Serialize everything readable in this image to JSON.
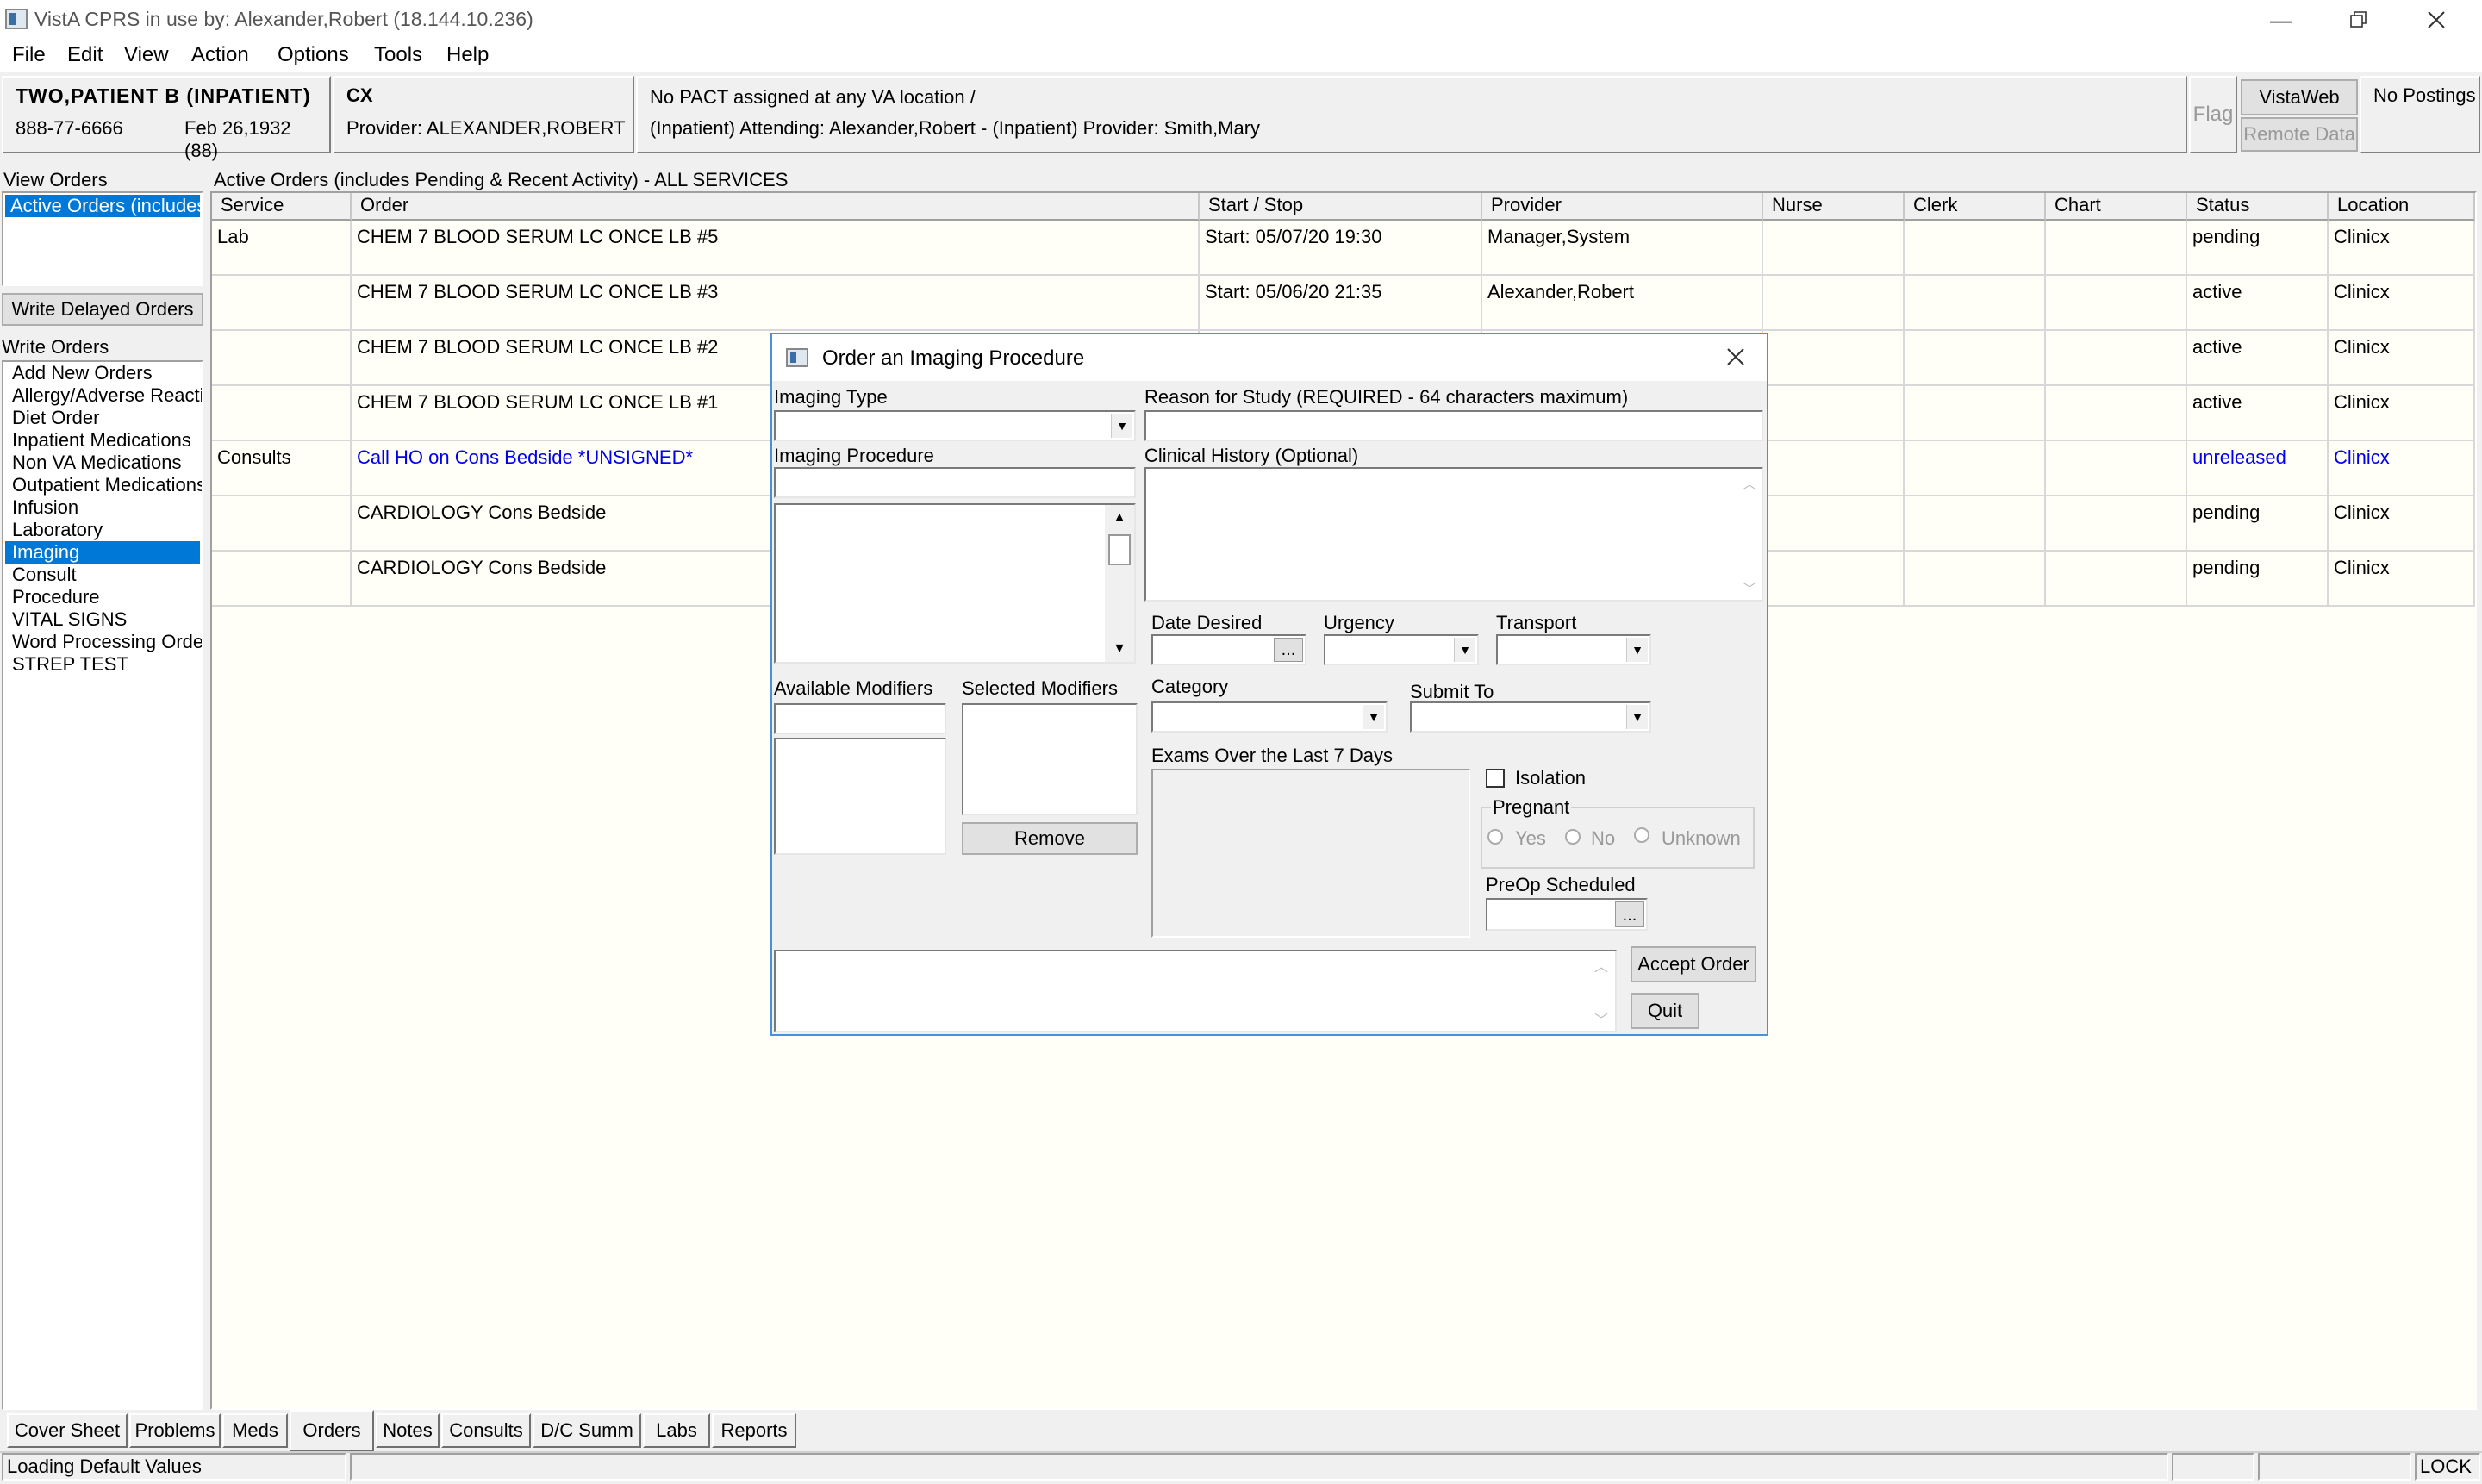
{
  "window": {
    "title": "VistA CPRS in use by: Alexander,Robert  (18.144.10.236)"
  },
  "menu": [
    "File",
    "Edit",
    "View",
    "Action",
    "Options",
    "Tools",
    "Help"
  ],
  "header": {
    "patient_name": "TWO,PATIENT B (INPATIENT)",
    "patient_ssn": "888-77-6666",
    "patient_dob": "Feb 26,1932 (88)",
    "location_code": "CX",
    "provider": "Provider:  ALEXANDER,ROBERT",
    "pact_line1": "No PACT assigned at any VA location /",
    "pact_line2": "(Inpatient) Attending:  Alexander,Robert - (Inpatient) Provider: Smith,Mary",
    "flag": "Flag",
    "vistaweb": "VistaWeb",
    "remote_data": "Remote Data",
    "postings": "No Postings"
  },
  "left_panel": {
    "view_orders_label": "View Orders",
    "view_orders_selected": "Active Orders (includes",
    "write_delayed_button": "Write Delayed Orders",
    "write_orders_label": "Write Orders",
    "write_orders_items": [
      "Add New Orders",
      "Allergy/Adverse Reacti",
      "Diet Order",
      "Inpatient Medications",
      "Non VA Medications",
      "Outpatient Medications",
      "Infusion",
      "Laboratory",
      "Imaging",
      "Consult",
      "Procedure",
      "VITAL SIGNS",
      "Word Processing Order",
      "STREP TEST"
    ],
    "selected_item": "Imaging"
  },
  "orders": {
    "caption": "Active Orders (includes Pending & Recent Activity) - ALL SERVICES",
    "columns": [
      "Service",
      "Order",
      "Start / Stop",
      "Provider",
      "Nurse",
      "Clerk",
      "Chart",
      "Status",
      "Location"
    ],
    "rows": [
      {
        "service": "Lab",
        "order": "CHEM 7 BLOOD   SERUM LC ONCE LB #5",
        "start": "Start: 05/07/20 19:30",
        "provider": "Manager,System",
        "status": "pending",
        "location": "Clinicx",
        "link": false
      },
      {
        "service": "",
        "order": "CHEM 7 BLOOD   SERUM LC ONCE LB #3",
        "start": "Start: 05/06/20 21:35",
        "provider": "Alexander,Robert",
        "status": "active",
        "location": "Clinicx",
        "link": false
      },
      {
        "service": "",
        "order": "CHEM 7 BLOOD   SERUM LC ONCE LB #2",
        "start": "",
        "provider": "",
        "status": "active",
        "location": "Clinicx",
        "link": false
      },
      {
        "service": "",
        "order": "CHEM 7 BLOOD   SERUM LC ONCE LB #1",
        "start": "",
        "provider": "",
        "status": "active",
        "location": "Clinicx",
        "link": false
      },
      {
        "service": "Consults",
        "order": "Call HO on Cons Bedside *UNSIGNED*",
        "start": "",
        "provider": "",
        "status": "unreleased",
        "location": "Clinicx",
        "link": true
      },
      {
        "service": "",
        "order": "CARDIOLOGY Cons Bedside",
        "start": "",
        "provider": "",
        "status": "pending",
        "location": "Clinicx",
        "link": false
      },
      {
        "service": "",
        "order": "CARDIOLOGY Cons Bedside",
        "start": "",
        "provider": "",
        "status": "pending",
        "location": "Clinicx",
        "link": false
      }
    ]
  },
  "dialog": {
    "title": "Order an Imaging Procedure",
    "imaging_type_label": "Imaging Type",
    "reason_label": "Reason for Study (REQUIRED - 64 characters maximum)",
    "imaging_procedure_label": "Imaging Procedure",
    "clinical_history_label": "Clinical History (Optional)",
    "date_desired_label": "Date Desired",
    "urgency_label": "Urgency",
    "transport_label": "Transport",
    "category_label": "Category",
    "submit_to_label": "Submit To",
    "available_modifiers_label": "Available Modifiers",
    "selected_modifiers_label": "Selected Modifiers",
    "remove_button": "Remove",
    "exams_label": "Exams Over the Last 7 Days",
    "isolation_label": "Isolation",
    "pregnant_label": "Pregnant",
    "pregnant_options": [
      "Yes",
      "No",
      "Unknown"
    ],
    "preop_label": "PreOp Scheduled",
    "accept_button": "Accept Order",
    "quit_button": "Quit"
  },
  "tabs": [
    "Cover Sheet",
    "Problems",
    "Meds",
    "Orders",
    "Notes",
    "Consults",
    "D/C Summ",
    "Labs",
    "Reports"
  ],
  "active_tab": "Orders",
  "status": {
    "message": "Loading Default Values",
    "lock": "LOCK"
  }
}
